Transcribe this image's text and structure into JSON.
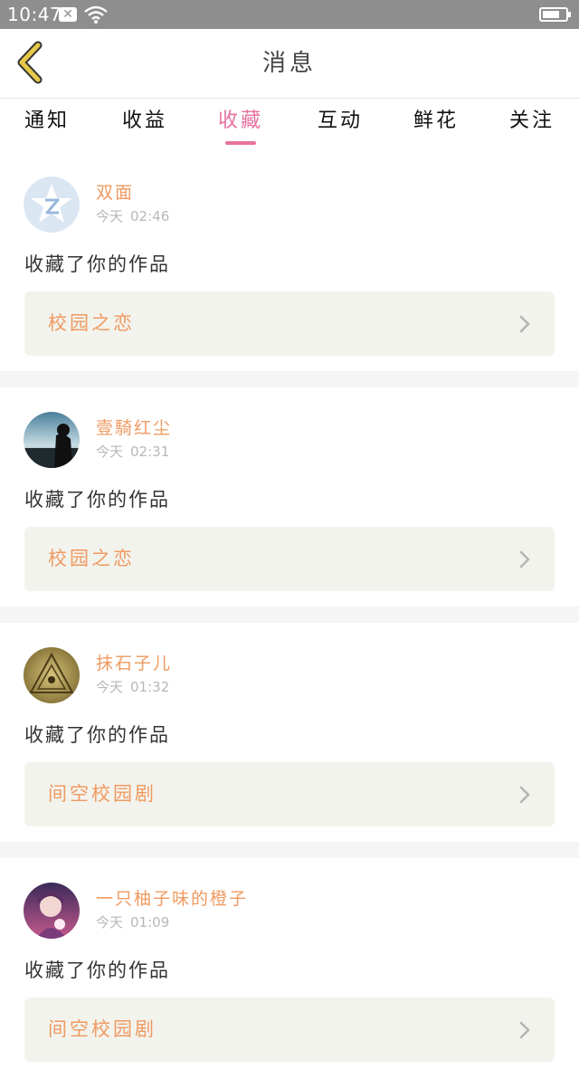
{
  "status_bar": {
    "time": "10:47",
    "notification_icon": "close-box-icon",
    "wifi_icon": "wifi-icon",
    "battery_icon": "battery-icon"
  },
  "header": {
    "title": "消息",
    "back_icon": "chevron-left-icon",
    "back_color": "#e6c84a"
  },
  "tabs": [
    {
      "label": "通知",
      "active": false
    },
    {
      "label": "收益",
      "active": false
    },
    {
      "label": "收藏",
      "active": true
    },
    {
      "label": "互动",
      "active": false
    },
    {
      "label": "鲜花",
      "active": false
    },
    {
      "label": "关注",
      "active": false
    }
  ],
  "accent_color": "#e8719e",
  "name_color": "#ef9a61",
  "messages": [
    {
      "username": "双面",
      "day": "今天",
      "time": "02:46",
      "action": "收藏了你的作品",
      "work_title": "校园之恋",
      "avatar": "qq-default-avatar"
    },
    {
      "username": "壹騎红尘",
      "day": "今天",
      "time": "02:31",
      "action": "收藏了你的作品",
      "work_title": "校园之恋",
      "avatar": "silhouette-seaside-avatar"
    },
    {
      "username": "抹石子儿",
      "day": "今天",
      "time": "01:32",
      "action": "收藏了你的作品",
      "work_title": "间空校园剧",
      "avatar": "triangle-eye-avatar"
    },
    {
      "username": "一只柚子味的橙子",
      "day": "今天",
      "time": "01:09",
      "action": "收藏了你的作品",
      "work_title": "间空校园剧",
      "avatar": "anime-girl-avatar"
    }
  ]
}
